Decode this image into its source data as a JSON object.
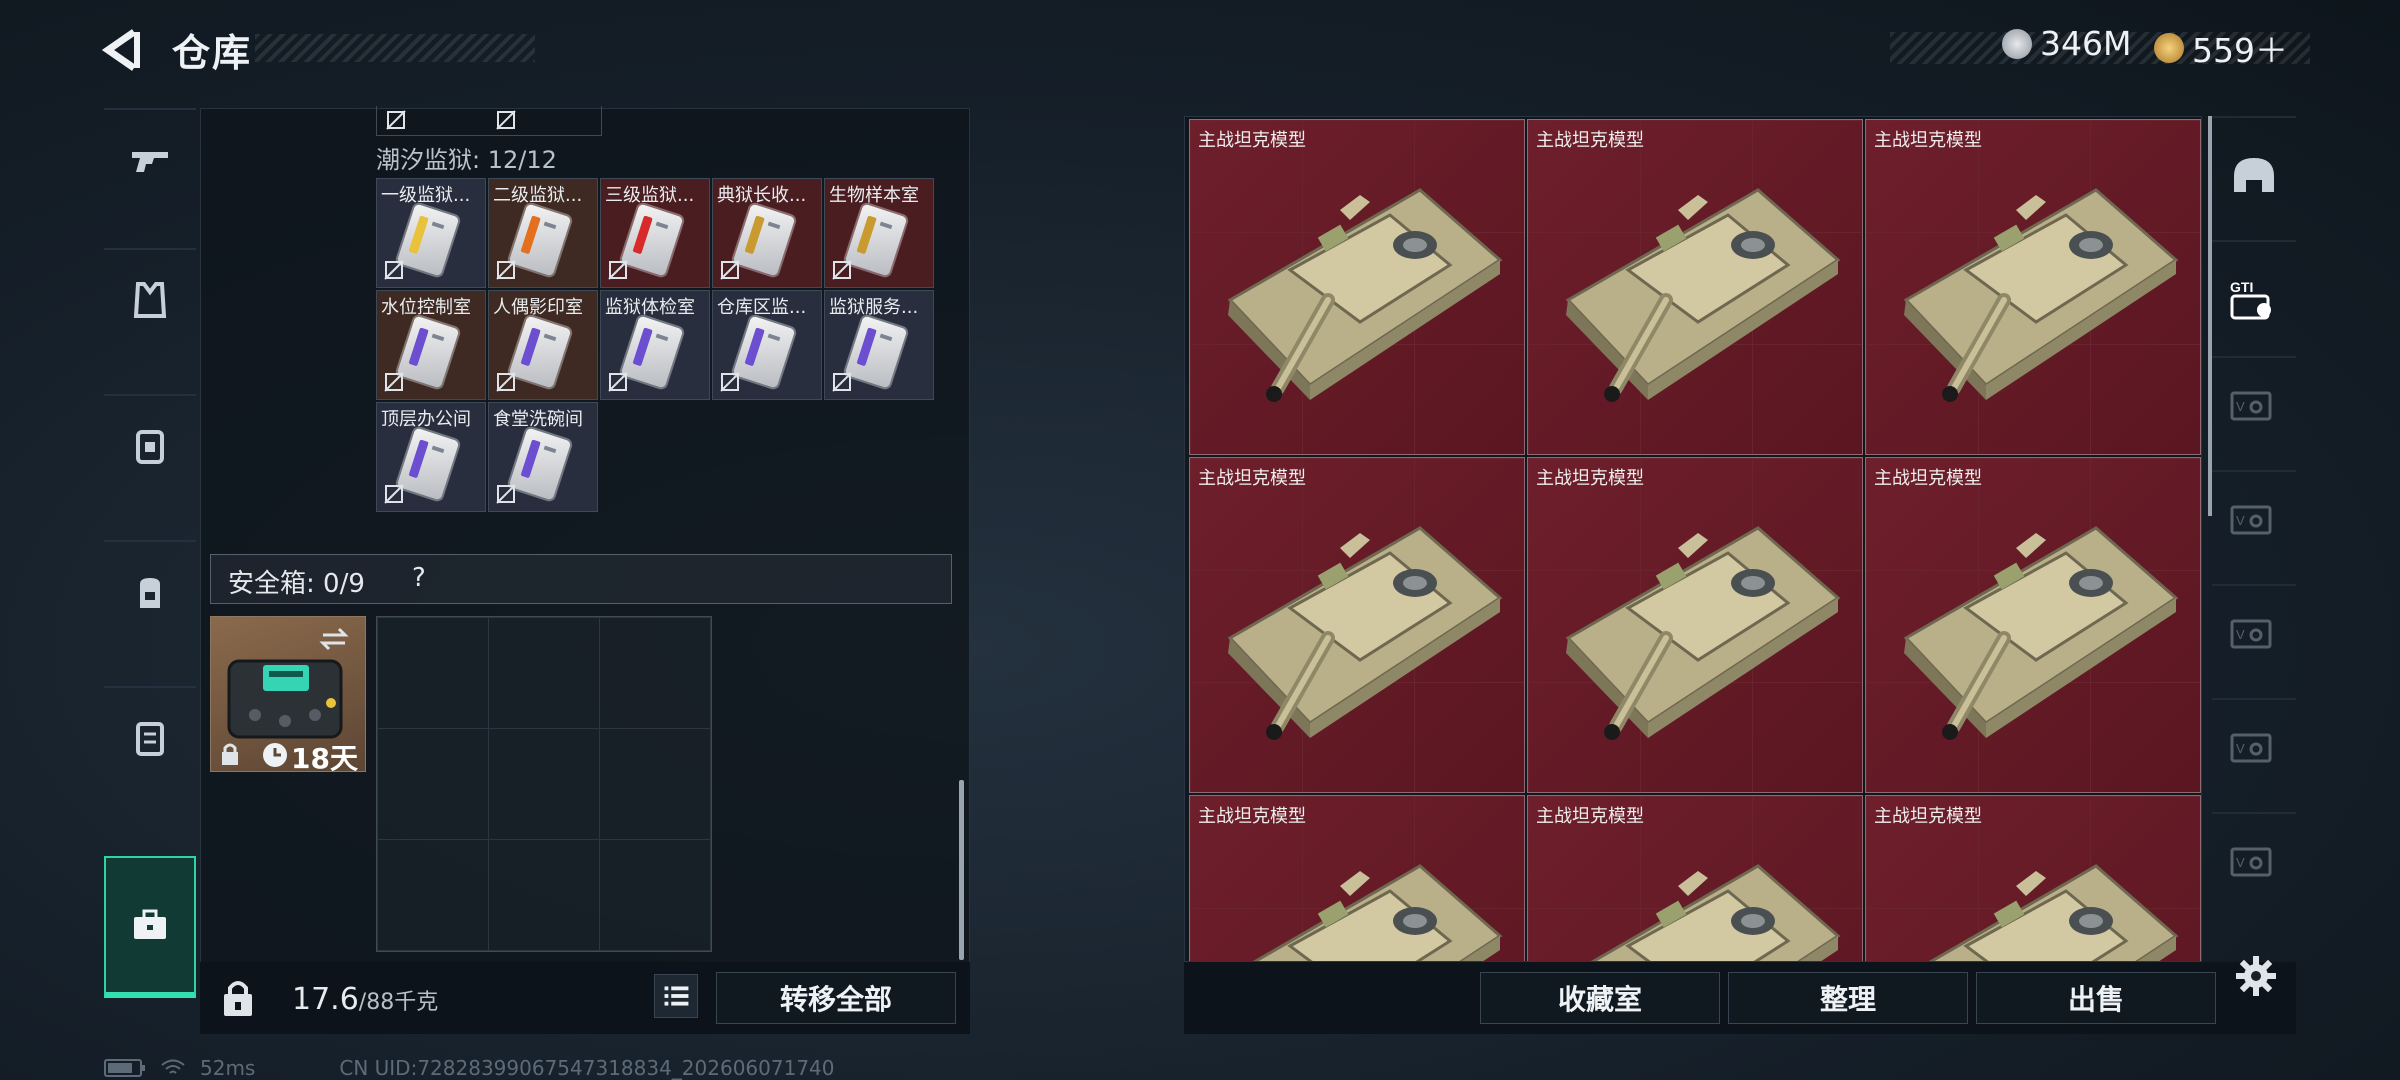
{
  "header": {
    "title": "仓库"
  },
  "currency": {
    "silver": "346M",
    "gold": "559＋"
  },
  "nav": {
    "items": [
      "weapon",
      "armor",
      "rig",
      "backpack",
      "container",
      "safebox"
    ],
    "active": "safebox"
  },
  "left": {
    "prison_label": "潮汐监狱: 12/12",
    "cards": [
      {
        "label": "一级监狱...",
        "stripe": "#e8c23b",
        "bg": "#282e3d"
      },
      {
        "label": "二级监狱...",
        "stripe": "#e4701f",
        "bg": "#3e2a22"
      },
      {
        "label": "三级监狱...",
        "stripe": "#d72a2a",
        "bg": "#4a1d21"
      },
      {
        "label": "典狱长收...",
        "stripe": "#c99a2f",
        "bg": "#4a1d21"
      },
      {
        "label": "生物样本室",
        "stripe": "#c99a2f",
        "bg": "#4a1d21"
      },
      {
        "label": "水位控制室",
        "stripe": "#6c4fd0",
        "bg": "#3e2a22"
      },
      {
        "label": "人偶影印室",
        "stripe": "#6c4fd0",
        "bg": "#3e2a22"
      },
      {
        "label": "监狱体检室",
        "stripe": "#6c4fd0",
        "bg": "#282e3d"
      },
      {
        "label": "仓库区监...",
        "stripe": "#6c4fd0",
        "bg": "#282e3d"
      },
      {
        "label": "监狱服务...",
        "stripe": "#6c4fd0",
        "bg": "#282e3d"
      },
      {
        "label": "顶层办公间",
        "stripe": "#6c4fd0",
        "bg": "#282e3d"
      },
      {
        "label": "食堂洗碗间",
        "stripe": "#6c4fd0",
        "bg": "#282e3d"
      }
    ],
    "safe_label": "安全箱: 0/9",
    "safe_help": "?",
    "safebox_time": "18天",
    "weight": "17.6",
    "weight_max": "/88千克",
    "transfer_all": "转移全部"
  },
  "right": {
    "item_name": "主战坦克模型",
    "items": [
      "主战坦克模型",
      "主战坦克模型",
      "主战坦克模型",
      "主战坦克模型",
      "主战坦克模型",
      "主战坦克模型",
      "主战坦克模型",
      "主战坦克模型",
      "主战坦克模型"
    ],
    "buttons": {
      "collection": "收藏室",
      "sort": "整理",
      "sell": "出售"
    }
  },
  "status": {
    "latency": "52ms",
    "uid": "CN UID:7282839906754731883​4_202606071740"
  },
  "colors": {
    "accent": "#34e0b0",
    "tank_bg": "#6e1f2b",
    "panel": "#0e141b"
  }
}
